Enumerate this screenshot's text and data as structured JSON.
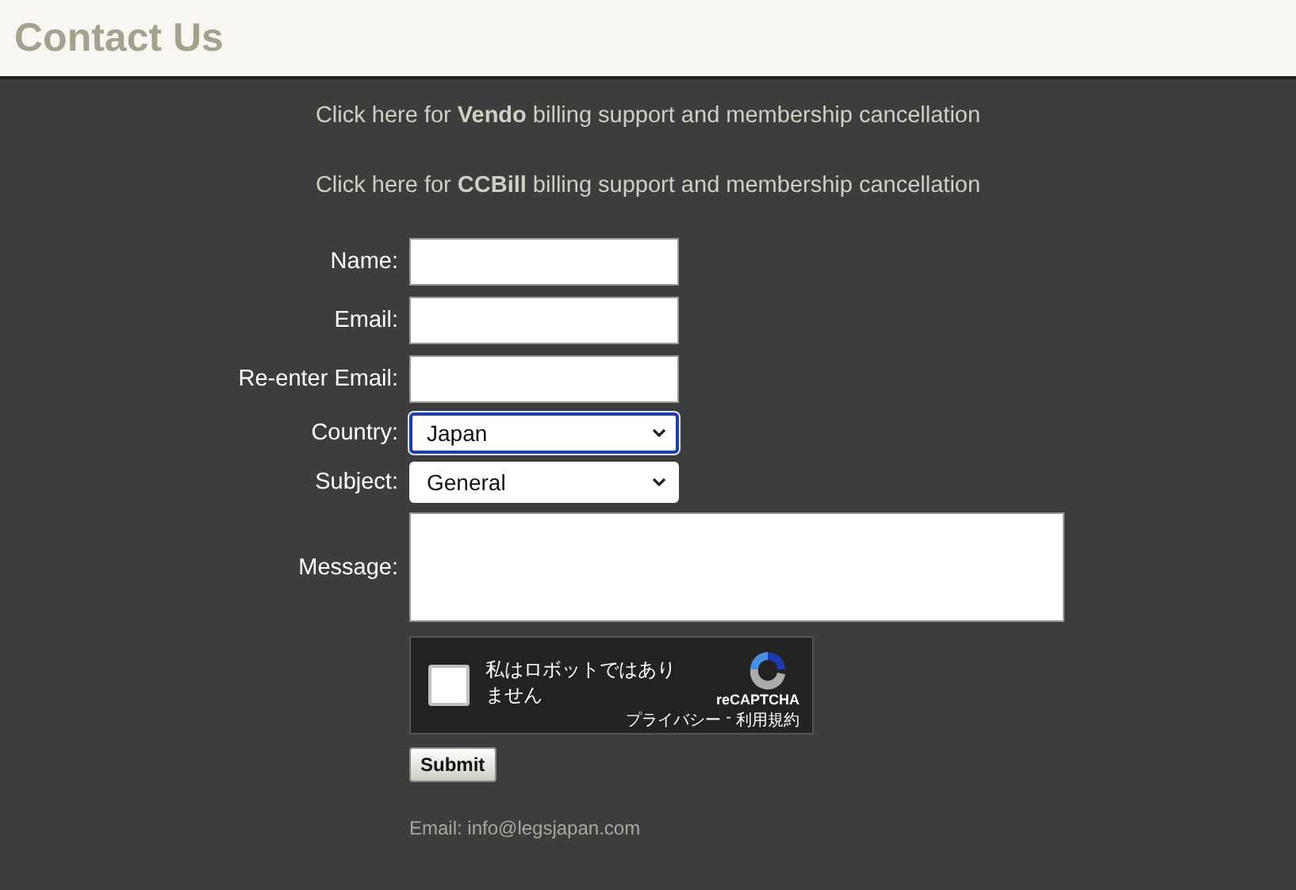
{
  "header": {
    "title": "Contact Us"
  },
  "links": [
    "Click here for **Vendo** billing support and membership cancellation",
    "Click here for **CCBill** billing support and membership cancellation"
  ],
  "fields": [
    {
      "kind": "text",
      "label": "Name:",
      "focused": false
    },
    {
      "kind": "text",
      "label": "Email:",
      "focused": false
    },
    {
      "kind": "text",
      "label": "Re-enter Email:",
      "focused": false
    },
    {
      "kind": "select",
      "label": "Country:",
      "value": "Japan",
      "focused": true
    },
    {
      "kind": "select",
      "label": "Subject:",
      "value": "General",
      "focused": false
    },
    {
      "kind": "textarea",
      "label": "Message:",
      "focused": false
    }
  ],
  "captcha": {
    "label": "私はロボットではありません",
    "checked": false,
    "brand": "reCAPTCHA",
    "privacy": "プライバシー",
    "separator": "-",
    "terms": "利用規約"
  },
  "submit": "Submit",
  "footer": "Email: info@legsjapan.com"
}
